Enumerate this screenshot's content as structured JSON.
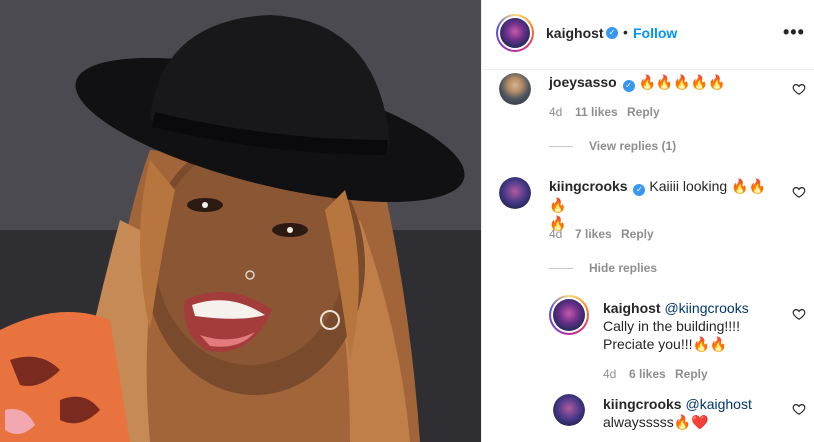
{
  "post_header": {
    "username": "kaighost",
    "verified_icon": "verified-badge-icon",
    "separator": "•",
    "follow_label": "Follow",
    "more_icon": "more-options-icon",
    "more_label": "•••"
  },
  "comments": [
    {
      "username": "joeysasso",
      "text": "🔥🔥🔥🔥🔥",
      "age": "4d",
      "likes": "11 likes",
      "reply_label": "Reply",
      "thread_label": "View replies (1)"
    },
    {
      "username": "kiingcrooks",
      "text_line1": "Kaiiii looking 🔥🔥🔥",
      "text_line2": "🔥",
      "age": "4d",
      "likes": "7 likes",
      "reply_label": "Reply",
      "thread_label": "Hide replies"
    }
  ],
  "replies": [
    {
      "username": "kaighost",
      "mention": "@kiingcrooks",
      "text_line1": "Cally in the building!!!!",
      "text_line2": "Preciate you!!!🔥🔥",
      "age": "4d",
      "likes": "6 likes",
      "reply_label": "Reply"
    },
    {
      "username": "kiingcrooks",
      "mention": "@kaighost",
      "text_line1": "alwaysssss🔥❤️"
    }
  ],
  "colors": {
    "link_blue": "#0095f6",
    "verified_blue": "#3897f0",
    "meta_gray": "#8e8e8e"
  }
}
